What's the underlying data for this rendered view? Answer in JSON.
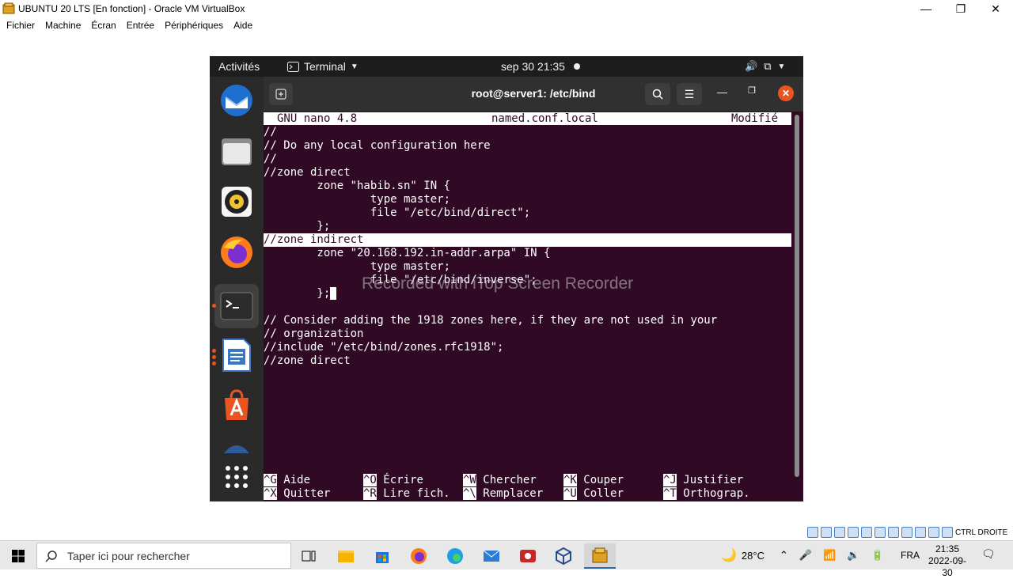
{
  "vbox": {
    "title": "UBUNTU 20 LTS [En fonction] - Oracle VM VirtualBox",
    "menus": [
      "Fichier",
      "Machine",
      "Écran",
      "Entrée",
      "Périphériques",
      "Aide"
    ],
    "host_key": "CTRL DROITE"
  },
  "gnome": {
    "activities": "Activités",
    "app_name": "Terminal",
    "clock": "sep 30  21:35"
  },
  "terminal": {
    "title": "root@server1: /etc/bind"
  },
  "nano": {
    "version": "GNU nano 4.8",
    "filename": "named.conf.local",
    "status": "Modifié",
    "lines": [
      "//",
      "// Do any local configuration here",
      "//",
      "//zone direct",
      "        zone \"habib.sn\" IN {",
      "                type master;",
      "                file \"/etc/bind/direct\";",
      "        };",
      "//zone indirect",
      "        zone \"20.168.192.in-addr.arpa\" IN {",
      "                type master;",
      "                file \"/etc/bind/inverse\";",
      "        };",
      "",
      "// Consider adding the 1918 zones here, if they are not used in your",
      "// organization",
      "//include \"/etc/bind/zones.rfc1918\";",
      "//zone direct"
    ],
    "shortcuts_row1": [
      {
        "key": "^G",
        "label": "Aide"
      },
      {
        "key": "^O",
        "label": "Écrire"
      },
      {
        "key": "^W",
        "label": "Chercher"
      },
      {
        "key": "^K",
        "label": "Couper"
      },
      {
        "key": "^J",
        "label": "Justifier"
      }
    ],
    "shortcuts_row2": [
      {
        "key": "^X",
        "label": "Quitter"
      },
      {
        "key": "^R",
        "label": "Lire fich."
      },
      {
        "key": "^\\",
        "label": "Remplacer"
      },
      {
        "key": "^U",
        "label": "Coller"
      },
      {
        "key": "^T",
        "label": "Orthograp."
      }
    ]
  },
  "watermark": "Recorded with iTop Screen Recorder",
  "taskbar": {
    "search_placeholder": "Taper ici pour rechercher",
    "weather": "28°C",
    "lang": "FRA",
    "time": "21:35",
    "date": "2022-09-30"
  },
  "colors": {
    "terminal_bg": "#300a24",
    "ubuntu_orange": "#e95420"
  }
}
